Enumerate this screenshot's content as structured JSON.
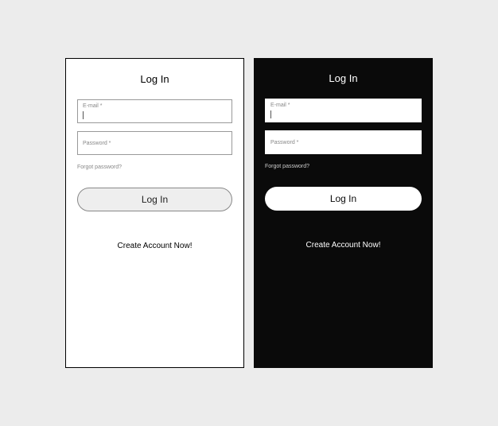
{
  "light": {
    "title": "Log In",
    "email_label": "E-mail *",
    "password_label": "Password *",
    "forgot": "Forgot password?",
    "login_button": "Log In",
    "create_account": "Create Account Now!"
  },
  "dark": {
    "title": "Log In",
    "email_label": "E-mail *",
    "password_label": "Password *",
    "forgot": "Forgot password?",
    "login_button": "Log In",
    "create_account": "Create Account Now!"
  }
}
